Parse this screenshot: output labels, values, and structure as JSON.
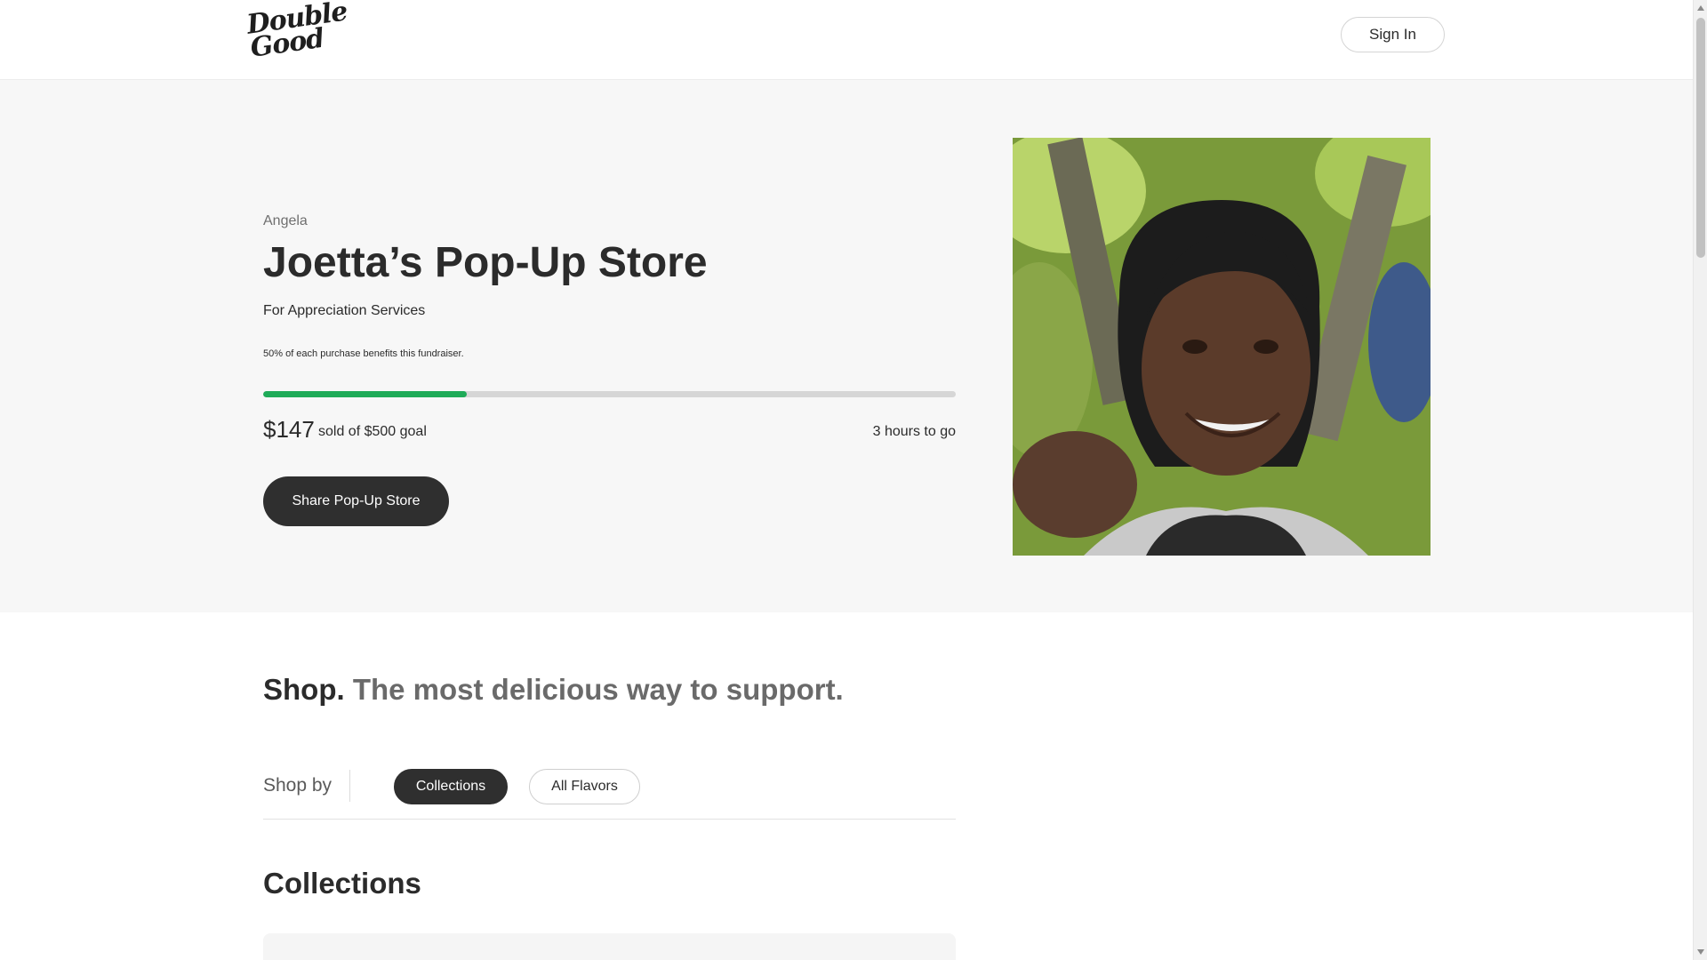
{
  "header": {
    "logo_line1": "Double",
    "logo_line2": "Good",
    "sign_in_label": "Sign In"
  },
  "hero": {
    "owner_name": "Angela",
    "store_title": "Joetta’s Pop-Up Store",
    "subtitle": "For Appreciation Services",
    "benefit_note": "50% of each purchase benefits this fundraiser.",
    "progress_fraction": 0.294,
    "raised_amount": "$147",
    "goal_text": "sold of $500 goal",
    "time_remaining": "3 hours to go",
    "share_button_label": "Share Pop-Up Store",
    "colors": {
      "progress": "#1fab58",
      "button": "#2f2f2f",
      "background": "#f7f7f7"
    }
  },
  "shop": {
    "heading_strong": "Shop.",
    "heading_muted": "The most delicious way to support.",
    "shop_by_label": "Shop by",
    "tabs": [
      {
        "label": "Collections",
        "active": true
      },
      {
        "label": "All Flavors",
        "active": false
      }
    ],
    "collections_title": "Collections"
  }
}
